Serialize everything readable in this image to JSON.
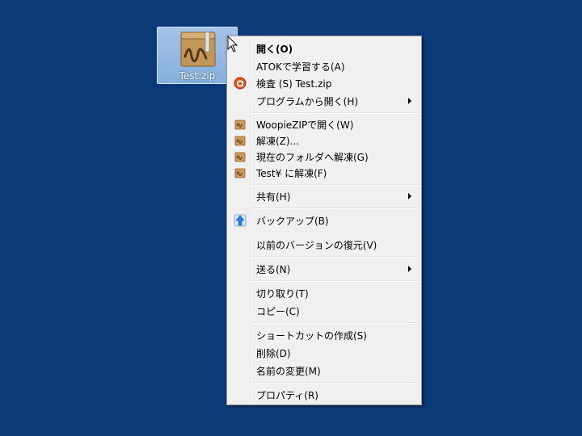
{
  "desktop": {
    "background_color": "#0b3a78",
    "icon": {
      "label": "Test.zip",
      "icon_name": "zip-archive-icon"
    }
  },
  "context_menu": {
    "items": [
      {
        "label": "開く(O)"
      },
      {
        "label": "ATOKで学習する(A)"
      },
      {
        "label": "検査 (S) Test.zip",
        "icon": "antivirus-scan-icon"
      },
      {
        "label": "プログラムから開く(H)",
        "submenu": true
      },
      {
        "label": "WoopieZIPで開く(W)",
        "icon": "woopiezip-icon"
      },
      {
        "label": "解凍(Z)...",
        "icon": "woopiezip-icon"
      },
      {
        "label": "現在のフォルダへ解凍(G)",
        "icon": "woopiezip-icon"
      },
      {
        "label": "Test¥ に解凍(F)",
        "icon": "woopiezip-icon"
      },
      {
        "label": "共有(H)",
        "submenu": true
      },
      {
        "label": "バックアップ(B)",
        "icon": "backup-upload-icon"
      },
      {
        "label": "以前のバージョンの復元(V)"
      },
      {
        "label": "送る(N)",
        "submenu": true
      },
      {
        "label": "切り取り(T)"
      },
      {
        "label": "コピー(C)"
      },
      {
        "label": "ショートカットの作成(S)"
      },
      {
        "label": "削除(D)"
      },
      {
        "label": "名前の変更(M)"
      },
      {
        "label": "プロパティ(R)"
      }
    ]
  }
}
